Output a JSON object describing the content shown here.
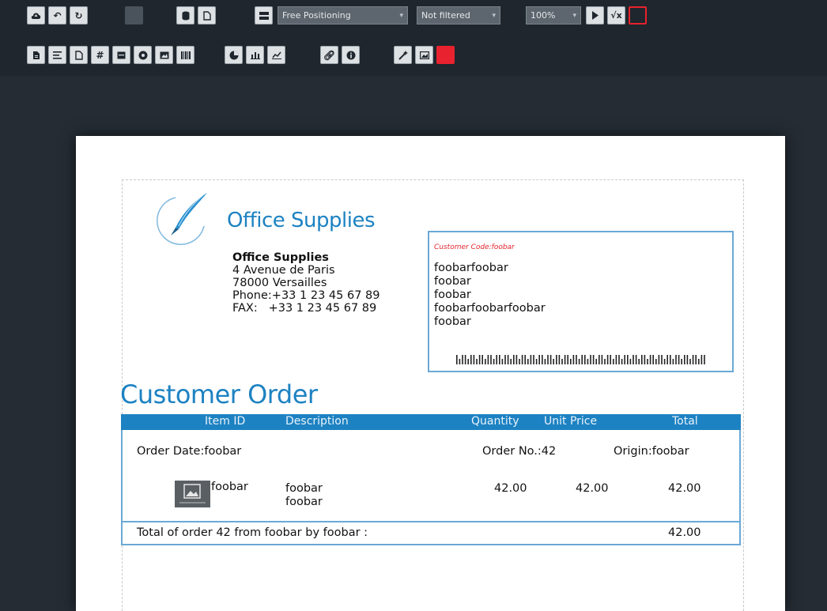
{
  "toolbar": {
    "zoom": "100%",
    "positioning": "Free Positioning",
    "filter": "Not filtered",
    "row1_icons": [
      "cloud-upload-icon",
      "undo-icon",
      "redo-icon",
      "disabled-icon",
      "database-icon",
      "page-icon",
      "band-icon"
    ],
    "row2_icons": [
      "document-icon",
      "text-icon",
      "page-number-icon",
      "hash-icon",
      "calendar-icon",
      "circle-icon",
      "image-icon",
      "barcode-icon",
      "pie-chart-icon",
      "bar-chart-icon",
      "line-chart-icon",
      "link-icon",
      "info-icon",
      "magic-icon",
      "image-frame-icon",
      "red-square-icon"
    ],
    "colors": {
      "bg": "#1f262d",
      "button": "#dde1e4",
      "danger": "#e8222e"
    }
  },
  "report": {
    "logo_title": "Office Supplies",
    "company": {
      "name": "Office Supplies",
      "street": "4 Avenue de Paris",
      "city": "78000 Versailles",
      "phone": "Phone:+33 1 23 45 67 89",
      "fax": "FAX:   +33 1 23 45 67 89"
    },
    "customer": {
      "code_label": "Customer Code:foobar",
      "lines": [
        "foobarfoobar",
        "foobar",
        "foobar",
        "foobarfoobarfoobar",
        "foobar"
      ]
    },
    "order_title": "Customer Order",
    "columns": [
      "Item ID",
      "Description",
      "Quantity",
      "Unit Price",
      "Total"
    ],
    "order_date": "Order Date:foobar",
    "order_no": "Order No.:42",
    "origin": "Origin:foobar",
    "item": {
      "id": "foobar",
      "desc1": "foobar",
      "desc2": "foobar",
      "quantity": "42.00",
      "unit_price": "42.00",
      "total": "42.00"
    },
    "footer_text": "Total of order 42 from foobar by foobar :",
    "footer_total": "42.00",
    "accent_color": "#1d82c2"
  }
}
